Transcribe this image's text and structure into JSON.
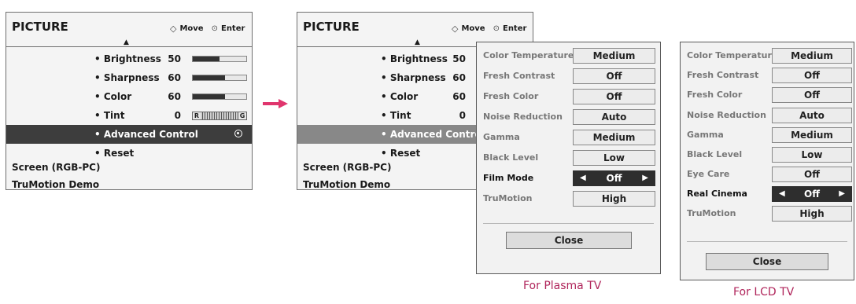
{
  "main_menu": {
    "title": "PICTURE",
    "hint_move": "Move",
    "hint_enter": "Enter",
    "items": [
      {
        "label": "• Brightness",
        "value": "50",
        "level": 0.5
      },
      {
        "label": "• Sharpness",
        "value": "60",
        "level": 0.6
      },
      {
        "label": "• Color",
        "value": "60",
        "level": 0.6
      },
      {
        "label": "• Tint",
        "value": "0",
        "tint_left": "R",
        "tint_right": "G"
      },
      {
        "label": "• Advanced Control"
      },
      {
        "label": "• Reset"
      }
    ],
    "advanced_control_truncated": "• Advanced Contro",
    "sub_items": [
      "Screen (RGB-PC)",
      "TruMotion Demo"
    ]
  },
  "plasma_popup": {
    "rows": [
      {
        "label": "Color Temperature",
        "value": "Medium"
      },
      {
        "label": "Fresh Contrast",
        "value": "Off"
      },
      {
        "label": "Fresh Color",
        "value": "Off"
      },
      {
        "label": "Noise Reduction",
        "value": "Auto"
      },
      {
        "label": "Gamma",
        "value": "Medium"
      },
      {
        "label": "Black Level",
        "value": "Low"
      },
      {
        "label": "Film Mode",
        "value": "Off"
      },
      {
        "label": "TruMotion",
        "value": "High"
      }
    ],
    "close": "Close",
    "caption": "For Plasma TV"
  },
  "lcd_popup": {
    "rows": [
      {
        "label": "Color Temperature",
        "value": "Medium"
      },
      {
        "label": "Fresh Contrast",
        "value": "Off"
      },
      {
        "label": "Fresh Color",
        "value": "Off"
      },
      {
        "label": "Noise Reduction",
        "value": "Auto"
      },
      {
        "label": "Gamma",
        "value": "Medium"
      },
      {
        "label": "Black Level",
        "value": "Low"
      },
      {
        "label": "Eye Care",
        "value": "Off"
      },
      {
        "label": "Real Cinema",
        "value": "Off"
      },
      {
        "label": "TruMotion",
        "value": "High"
      }
    ],
    "close": "Close",
    "caption": "For LCD TV"
  },
  "glyphs": {
    "left": "◀",
    "right": "▶",
    "up": "▲",
    "move": "◇",
    "enter": "⊙"
  },
  "colors": {
    "accent": "#b0255b",
    "arrow": "#e0356d",
    "selected_bg": "#3d3d3d"
  }
}
